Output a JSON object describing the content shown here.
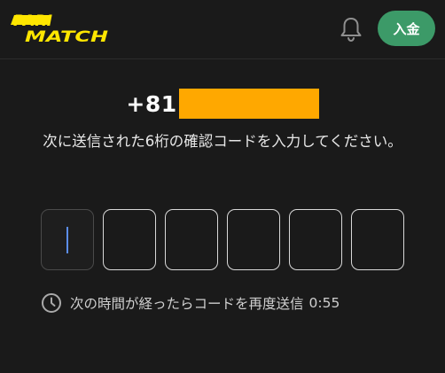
{
  "header": {
    "logo_line1": "PARI",
    "logo_line2": "MATCH",
    "deposit_label": "入金",
    "brand_color": "#ffe600",
    "accent_color": "#3c9a68"
  },
  "verification": {
    "phone_prefix": "+81",
    "phone_mask_color": "#ffa800",
    "instruction": "次に送信された6桁の確認コードを入力してください。",
    "code_digits": [
      "",
      "",
      "",
      "",
      "",
      ""
    ],
    "resend_text": "次の時間が経ったらコードを再度送信",
    "timer": "0:55"
  },
  "icons": {
    "notification": "bell-icon",
    "timer": "clock-icon"
  }
}
